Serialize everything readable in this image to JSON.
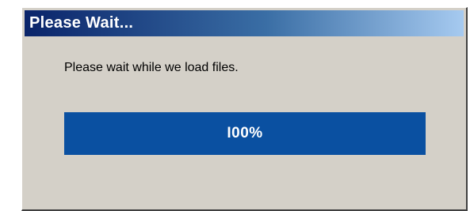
{
  "window": {
    "title": "Please Wait...",
    "message": "Please wait while we load files."
  },
  "progress": {
    "label": "I00%",
    "fraction": 1.0
  },
  "colors": {
    "title_gradient_start": "#0a246a",
    "title_gradient_end": "#a6caf0",
    "dialog_face": "#d4d0c8",
    "progress_fill": "#0a50a1",
    "progress_text": "#ffffff"
  }
}
